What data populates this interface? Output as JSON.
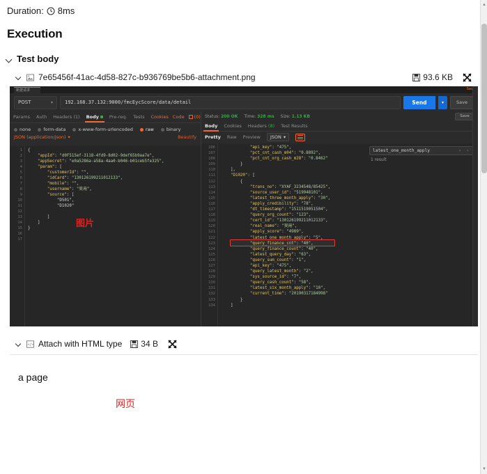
{
  "report": {
    "duration_label": "Duration:",
    "duration_value": "8ms",
    "clock_icon": "clock-icon",
    "execution_title": "Execution",
    "test_body_label": "Test body"
  },
  "attachment_png": {
    "name": "7e65456f-41ac-4d58-827c-b936769be5b6-attachment.png",
    "size": "93.6 KB",
    "file_icon": "floppy-save-icon",
    "type_icon": "image-file-icon",
    "expand_icon": "fullscreen-icon",
    "chevron_icon": "chevron-down-icon"
  },
  "attachment_html": {
    "name": "Attach with HTML type",
    "size": "34 B",
    "file_icon": "floppy-save-icon",
    "type_icon": "html-file-icon",
    "expand_icon": "fullscreen-icon",
    "chevron_icon": "chevron-down-icon",
    "content_text": "a page",
    "content_annotation": "网页"
  },
  "postman": {
    "tab_chip_label": "新建请求",
    "save_link": "Save",
    "method": "POST",
    "method_caret": "▾",
    "url": "192.168.37.132:9000/fmcEycScore/data/detail",
    "send_label": "Send",
    "send_caret": "▾",
    "save_button": "Save",
    "request_tabs": [
      {
        "label": "Params",
        "active": false
      },
      {
        "label": "Auth",
        "active": false
      },
      {
        "label": "Headers (1)",
        "active": false
      },
      {
        "label": "Body",
        "active": true
      },
      {
        "label": "Pre-req.",
        "active": false
      },
      {
        "label": "Tests",
        "active": false
      }
    ],
    "request_tabs_right": [
      "Cookies",
      "Code"
    ],
    "comment_count": "(0)",
    "body_types": [
      {
        "label": "none",
        "selected": false
      },
      {
        "label": "form-data",
        "selected": false
      },
      {
        "label": "x-www-form-urlencoded",
        "selected": false
      },
      {
        "label": "raw",
        "selected": true
      },
      {
        "label": "binary",
        "selected": false
      }
    ],
    "body_format": "JSON (application/json)",
    "body_format_caret": "▾",
    "beautify_label": "Beautify",
    "request_body_lines": [
      "{",
      "    \"appId\": \"d0F515ef-3118-4fd9-8d02-9def65b9aa7e\",",
      "    \"appSecret\": \"e0a5286a-a58a-4aa0-b046-b01ceb5fe325\",",
      "    \"param\": [",
      "        \"customerId\": \"\",",
      "        \"idCard\": \"130126199211012133\",",
      "        \"mobile\": \"\",",
      "        \"username\": \"吴用\",",
      "        \"source\": [",
      "            \"D501\",",
      "            \"D1020\"",
      "",
      "        ]",
      "    ]",
      "}",
      ""
    ],
    "request_gutter": [
      "1",
      "2",
      "3",
      "4",
      "5",
      "6",
      "7",
      "8",
      "9",
      "10",
      "11",
      "12",
      "13",
      "14",
      "15",
      "16",
      "17"
    ],
    "request_overlay_annotation": "图片",
    "response": {
      "status_label": "Status:",
      "status_value": "200 OK",
      "time_label": "Time:",
      "time_value": "328 ms",
      "size_label": "Size:",
      "size_value": "1.13 KB",
      "save_response": "Save",
      "tabs": [
        {
          "label": "Body",
          "active": true
        },
        {
          "label": "Cookies",
          "active": false
        },
        {
          "label": "Headers",
          "active": false,
          "count": "(8)"
        },
        {
          "label": "Test Results",
          "active": false
        }
      ],
      "format_tabs": [
        {
          "label": "Pretty",
          "active": true
        },
        {
          "label": "Raw",
          "active": false
        },
        {
          "label": "Preview",
          "active": false
        }
      ],
      "format_select": "JSON",
      "format_caret": "▾",
      "wrap_icon": "wrap-lines-icon",
      "search_value": "latest_one_month_apply",
      "search_results": "1 result",
      "search_prev_icon": "chevron-left-icon",
      "search_next_icon": "chevron-right-icon",
      "gutter": [
        "106",
        "107",
        "108",
        "109",
        "110",
        "111",
        "112",
        "113",
        "114",
        "115",
        "116",
        "117",
        "118",
        "119",
        "120",
        "121",
        "122",
        "123",
        "124",
        "125",
        "126",
        "127",
        "128",
        "129",
        "130",
        "131",
        "132",
        "133",
        "134"
      ],
      "lines": [
        "            \"api_key\": \"475\",",
        "            \"pct_cnt_cash_m04\": \"0.8892\",",
        "            \"pct_cnt_org_cash_m28\": \"0.8462\"",
        "        }",
        "    ],",
        "    \"D1020\": [",
        "        {",
        "            \"trans_no\": \"XYAF_3234548/85425\",",
        "            \"source_user_id\": \"519948101\",",
        "            \"latest_three_month_apply\": \"30\",",
        "            \"apply_credibility\": \"78\",",
        "            \"dt_timestamp\": \"1511519051504\",",
        "            \"query_org_count\": \"123\",",
        "            \"cert_id\": \"130126199211012133\",",
        "            \"real_name\": \"吴用\",",
        "            \"apply_score\": \"4989\",",
        "            \"latest_one_month_apply\": \"5\",",
        "            \"query_finance_cnt\": \"40\",",
        "            \"query_finance_count\": \"40\",",
        "            \"latest_query_day\": \"63\",",
        "            \"query_sum_count\": \"1\",",
        "            \"api_key\": \"475\",",
        "            \"query_latest_month\": \"2\",",
        "            \"sys_source_id\": \"7\",",
        "            \"query_cash_count\": \"58\",",
        "            \"latest_six_month_apply\": \"10\",",
        "            \"current_time\": \"20190317184998\"",
        "        }",
        "    ]"
      ],
      "highlight_term": "latest_one_month_apply"
    }
  },
  "scrollbar": {
    "up_arrow": "▲",
    "down_arrow": "▼"
  },
  "colors": {
    "accent_orange": "#f1692c",
    "send_blue": "#1b77e8",
    "status_green": "#3fa34a",
    "highlight_red": "#e23b3b",
    "annotation_red": "#dd2222"
  }
}
